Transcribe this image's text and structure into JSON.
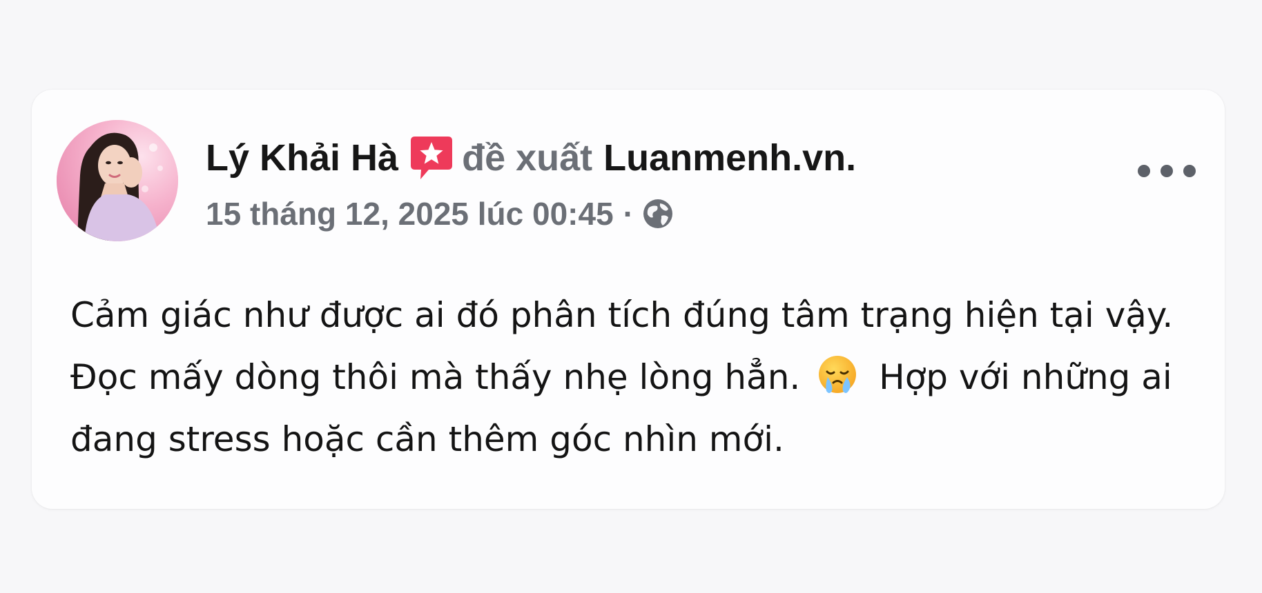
{
  "post": {
    "author_name": "Lý Khải Hà",
    "action_text": "đề xuất",
    "page_name": "Luanmenh.vn",
    "period": ".",
    "timestamp": "15 tháng 12, 2025 lúc 00:45",
    "separator": "·",
    "privacy_icon": "globe-icon",
    "recommend_icon": "recommend-star-icon",
    "more_icon": "more-options-icon",
    "body": {
      "line1": "Cảm giác như được ai đó phân tích đúng tâm trạng hiện tại vậy.",
      "line2_before": "Đọc mấy dòng thôi mà thấy nhẹ lòng hẳn.",
      "line2_emoji": "crying-relief-emoji",
      "line2_after": "Hợp với những ai",
      "line3": "đang stress hoặc cần thêm góc nhìn mới."
    }
  },
  "colors": {
    "recommend_red": "#ee3a5a",
    "secondary_text": "#6b6f76",
    "primary_text": "#161616"
  }
}
